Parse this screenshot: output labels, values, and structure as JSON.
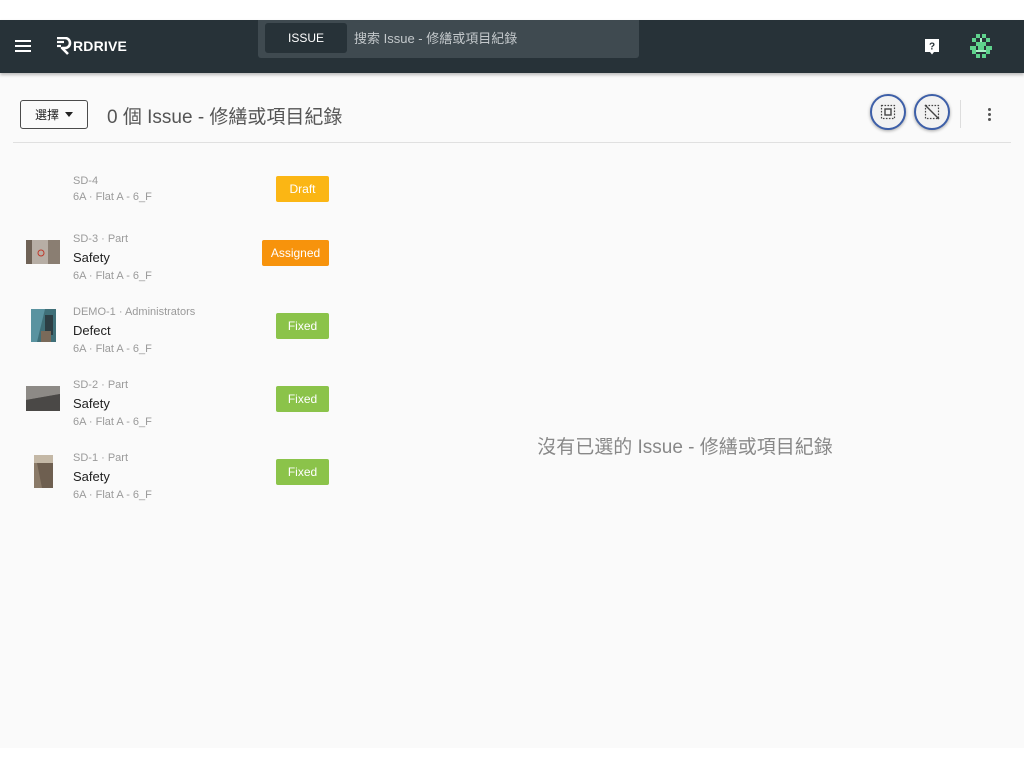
{
  "topbar": {
    "logo_text": "RDRIVE",
    "search_button_label": "ISSUE",
    "search_placeholder": "搜索 Issue - 修繕或項目紀錄"
  },
  "header": {
    "select_label": "選擇",
    "title": "0 個 Issue - 修繕或項目紀錄"
  },
  "issues": [
    {
      "code": "SD-4",
      "type": "",
      "location": "6A · Flat A - 6_F",
      "status": "Draft",
      "status_color": "#fbb614",
      "has_thumbnail": false
    },
    {
      "code": "SD-3 · Part",
      "type": "Safety",
      "location": "6A · Flat A - 6_F",
      "status": "Assigned",
      "status_color": "#f7930c",
      "has_thumbnail": true
    },
    {
      "code": "DEMO-1 · Administrators",
      "type": "Defect",
      "location": "6A · Flat A - 6_F",
      "status": "Fixed",
      "status_color": "#8bc34a",
      "has_thumbnail": true
    },
    {
      "code": "SD-2 · Part",
      "type": "Safety",
      "location": "6A · Flat A - 6_F",
      "status": "Fixed",
      "status_color": "#8bc34a",
      "has_thumbnail": true
    },
    {
      "code": "SD-1 · Part",
      "type": "Safety",
      "location": "6A · Flat A - 6_F",
      "status": "Fixed",
      "status_color": "#8bc34a",
      "has_thumbnail": true
    }
  ],
  "empty_message": "沒有已選的 Issue - 修繕或項目紀錄",
  "colors": {
    "topbar_bg": "#273238",
    "accent_ring": "#3d5fa8",
    "draft": "#fbb614",
    "assigned": "#f7930c",
    "fixed": "#8bc34a"
  },
  "icons": {
    "menu": "hamburger-menu-icon",
    "help": "help-icon",
    "avatar": "pixel-avatar",
    "select_all": "select-all-icon",
    "deselect": "deselect-icon",
    "more": "more-vert-icon"
  }
}
